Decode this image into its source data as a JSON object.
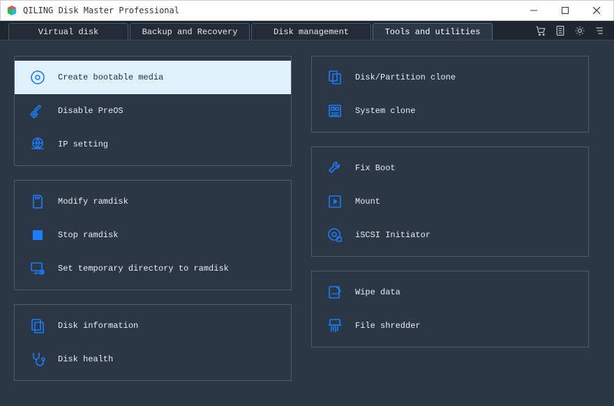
{
  "title": "QILING Disk Master Professional",
  "tabs": [
    {
      "label": "Virtual disk",
      "active": false
    },
    {
      "label": "Backup and Recovery",
      "active": false
    },
    {
      "label": "Disk management",
      "active": false
    },
    {
      "label": "Tools and utilities",
      "active": true
    }
  ],
  "left_panels": [
    {
      "items": [
        {
          "icon": "disc-icon",
          "label": "Create bootable media",
          "selected": true
        },
        {
          "icon": "gear-wrench-icon",
          "label": "Disable PreOS",
          "selected": false
        },
        {
          "icon": "globe-icon",
          "label": "IP setting",
          "selected": false
        }
      ]
    },
    {
      "items": [
        {
          "icon": "sdcard-icon",
          "label": "Modify ramdisk",
          "selected": false
        },
        {
          "icon": "stop-icon",
          "label": "Stop ramdisk",
          "selected": false
        },
        {
          "icon": "monitor-gear-icon",
          "label": "Set temporary directory to ramdisk",
          "selected": false
        }
      ]
    },
    {
      "items": [
        {
          "icon": "disk-info-icon",
          "label": "Disk information",
          "selected": false
        },
        {
          "icon": "stethoscope-icon",
          "label": "Disk health",
          "selected": false
        }
      ]
    }
  ],
  "right_panels": [
    {
      "items": [
        {
          "icon": "clone-icon",
          "label": "Disk/Partition clone",
          "selected": false
        },
        {
          "icon": "system-clone-icon",
          "label": "System clone",
          "selected": false
        }
      ]
    },
    {
      "items": [
        {
          "icon": "wrench-icon",
          "label": "Fix Boot",
          "selected": false
        },
        {
          "icon": "play-icon",
          "label": "Mount",
          "selected": false
        },
        {
          "icon": "iscsi-icon",
          "label": "iSCSI Initiator",
          "selected": false
        }
      ]
    },
    {
      "items": [
        {
          "icon": "wipe-icon",
          "label": "Wipe data",
          "selected": false
        },
        {
          "icon": "shredder-icon",
          "label": "File shredder",
          "selected": false
        }
      ]
    }
  ]
}
